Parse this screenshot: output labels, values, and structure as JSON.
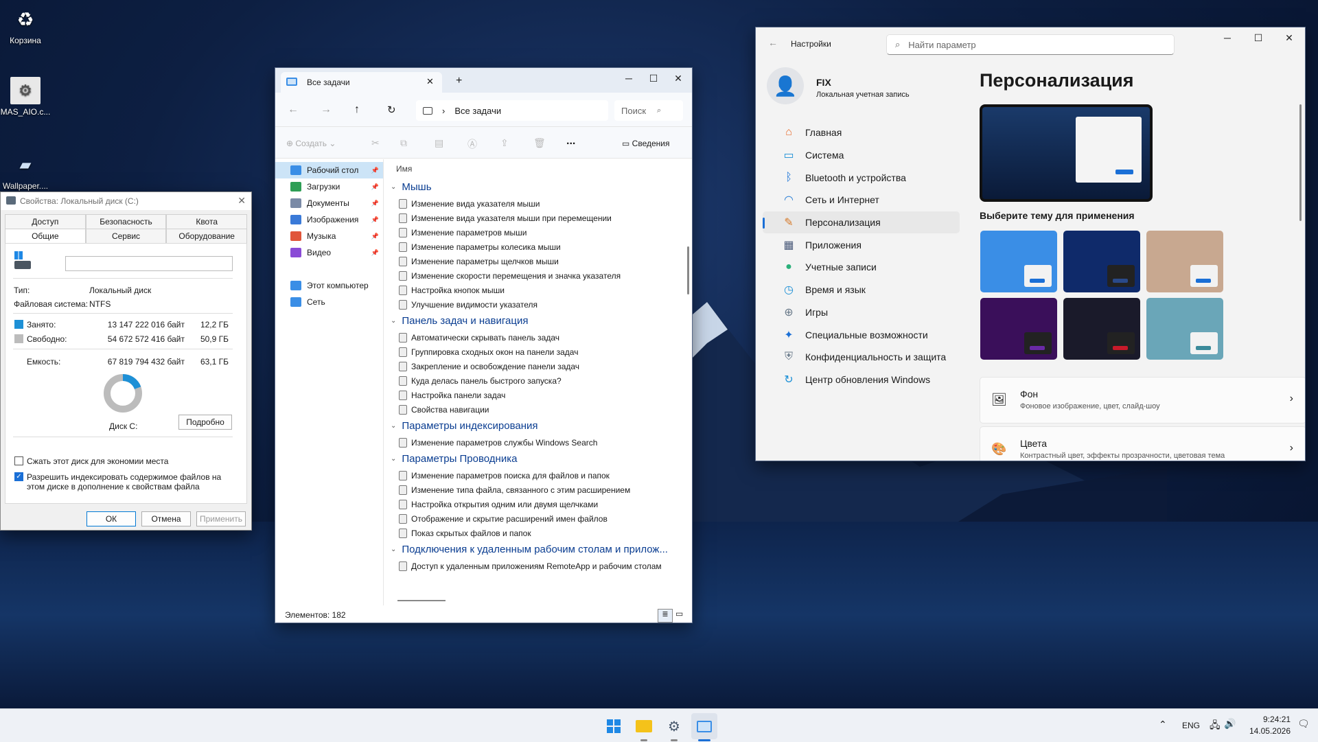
{
  "desktop": {
    "icons": [
      {
        "label": "Корзина",
        "icon": "recycle-bin-icon"
      },
      {
        "label": "MAS_AIO.c...",
        "icon": "script-file-icon"
      },
      {
        "label": "Wallpaper....",
        "icon": "image-file-icon"
      }
    ]
  },
  "properties": {
    "title": "Свойства: Локальный диск (C:)",
    "tabs_row1": [
      "Доступ",
      "Безопасность",
      "Квота"
    ],
    "tabs_row2": [
      "Общие",
      "Сервис",
      "Оборудование"
    ],
    "name_value": "",
    "type_label": "Тип:",
    "type_value": "Локальный диск",
    "fs_label": "Файловая система:",
    "fs_value": "NTFS",
    "used_label": "Занято:",
    "used_bytes": "13 147 222 016 байт",
    "used_gb": "12,2 ГБ",
    "free_label": "Свободно:",
    "free_bytes": "54 672 572 416 байт",
    "free_gb": "50,9 ГБ",
    "cap_label": "Емкость:",
    "cap_bytes": "67 819 794 432 байт",
    "cap_gb": "63,1 ГБ",
    "used_fraction": 0.194,
    "disk_label": "Диск C:",
    "details_button": "Подробно",
    "compress_label": "Сжать этот диск для экономии места",
    "index_label_1": "Разрешить индексировать содержимое файлов на",
    "index_label_2": "этом диске в дополнение к свойствам файла",
    "compress_checked": false,
    "index_checked": true,
    "ok": "ОК",
    "cancel": "Отмена",
    "apply": "Применить",
    "used_color": "#1e90d6",
    "free_color": "#bcbcbc"
  },
  "explorer": {
    "tab_title": "Все задачи",
    "address": "Все задачи",
    "search_placeholder": "Поиск",
    "create_label": "Создать",
    "details_label": "Сведения",
    "more": "...",
    "column_name": "Имя",
    "nav": [
      {
        "label": "Рабочий стол",
        "color": "#3a8ee6",
        "pinned": true,
        "selected": true
      },
      {
        "label": "Загрузки",
        "color": "#2e9e55",
        "pinned": true
      },
      {
        "label": "Документы",
        "color": "#7a8aa6",
        "pinned": true
      },
      {
        "label": "Изображения",
        "color": "#3a7ad8",
        "pinned": true
      },
      {
        "label": "Музыка",
        "color": "#e0553a",
        "pinned": true
      },
      {
        "label": "Видео",
        "color": "#8a4bd6",
        "pinned": true
      }
    ],
    "nav2": [
      {
        "label": "Этот компьютер",
        "color": "#3a8ee6"
      },
      {
        "label": "Сеть",
        "color": "#3a8ee6"
      }
    ],
    "groups": [
      {
        "title": "Мышь",
        "items": [
          "Изменение вида указателя мыши",
          "Изменение вида указателя мыши при перемещении",
          "Изменение параметров мыши",
          "Изменение параметры колесика мыши",
          "Изменение параметры щелчков мыши",
          "Изменение скорости перемещения и значка указателя",
          "Настройка кнопок мыши",
          "Улучшение видимости указателя"
        ]
      },
      {
        "title": "Панель задач и навигация",
        "items": [
          "Автоматически скрывать панель задач",
          "Группировка сходных окон на панели задач",
          "Закрепление и освобождение панели задач",
          "Куда делась панель быстрого запуска?",
          "Настройка панели задач",
          "Свойства навигации"
        ]
      },
      {
        "title": "Параметры индексирования",
        "items": [
          "Изменение параметров службы Windows Search"
        ]
      },
      {
        "title": "Параметры Проводника",
        "items": [
          "Изменение параметров поиска для файлов и папок",
          "Изменение типа файла, связанного с этим расширением",
          "Настройка открытия одним или двумя щелчками",
          "Отображение и скрытие расширений имен файлов",
          "Показ скрытых файлов и папок"
        ]
      },
      {
        "title": "Подключения к удаленным рабочим столам и прилож...",
        "items": [
          "Доступ к удаленным приложениям RemoteApp и рабочим столам"
        ]
      }
    ],
    "status": "Элементов: 182"
  },
  "settings": {
    "app_title": "Настройки",
    "search_placeholder": "Найти параметр",
    "user_name": "FIX",
    "user_sub": "Локальная учетная запись",
    "page_title": "Персонализация",
    "theme_heading": "Выберите тему для применения",
    "nav": [
      {
        "label": "Главная",
        "icon": "home-icon",
        "color": "#e86a2a"
      },
      {
        "label": "Система",
        "icon": "monitor-icon",
        "color": "#1a8fd6"
      },
      {
        "label": "Bluetooth и устройства",
        "icon": "bluetooth-icon",
        "color": "#1a73d6"
      },
      {
        "label": "Сеть и Интернет",
        "icon": "wifi-icon",
        "color": "#2a7fd6"
      },
      {
        "label": "Персонализация",
        "icon": "brush-icon",
        "color": "#d67a2a",
        "selected": true
      },
      {
        "label": "Приложения",
        "icon": "apps-icon",
        "color": "#4a5a7a"
      },
      {
        "label": "Учетные записи",
        "icon": "person-icon",
        "color": "#2ab07a"
      },
      {
        "label": "Время и язык",
        "icon": "globe-clock-icon",
        "color": "#1a8fd6"
      },
      {
        "label": "Игры",
        "icon": "gamepad-icon",
        "color": "#6a7a8a"
      },
      {
        "label": "Специальные возможности",
        "icon": "accessibility-icon",
        "color": "#1a6fd6"
      },
      {
        "label": "Конфиденциальность и защита",
        "icon": "shield-icon",
        "color": "#6a7a8a"
      },
      {
        "label": "Центр обновления Windows",
        "icon": "update-icon",
        "color": "#1a8fd6"
      }
    ],
    "themes": [
      {
        "bg": "#3a8ee6",
        "mini": "#1a6fd6",
        "light": true
      },
      {
        "bg": "#0f2a6a",
        "mini": "#2a4a8a",
        "light": false
      },
      {
        "bg": "#c8a890",
        "mini": "#1a6fd6",
        "light": true
      },
      {
        "bg": "#3a0f5a",
        "mini": "#6a2aa6",
        "light": false
      },
      {
        "bg": "#1a1a2a",
        "mini": "#c81a2a",
        "light": false
      },
      {
        "bg": "#6aa6b8",
        "mini": "#3a8a9a",
        "light": true
      }
    ],
    "cards": [
      {
        "title": "Фон",
        "sub": "Фоновое изображение, цвет, слайд-шоу",
        "icon": "image-icon"
      },
      {
        "title": "Цвета",
        "sub": "Контрастный цвет, эффекты прозрачности, цветовая тема",
        "icon": "palette-icon"
      }
    ]
  },
  "taskbar": {
    "lang": "ENG",
    "time": "9:24:21",
    "date": "14.05.2026"
  }
}
